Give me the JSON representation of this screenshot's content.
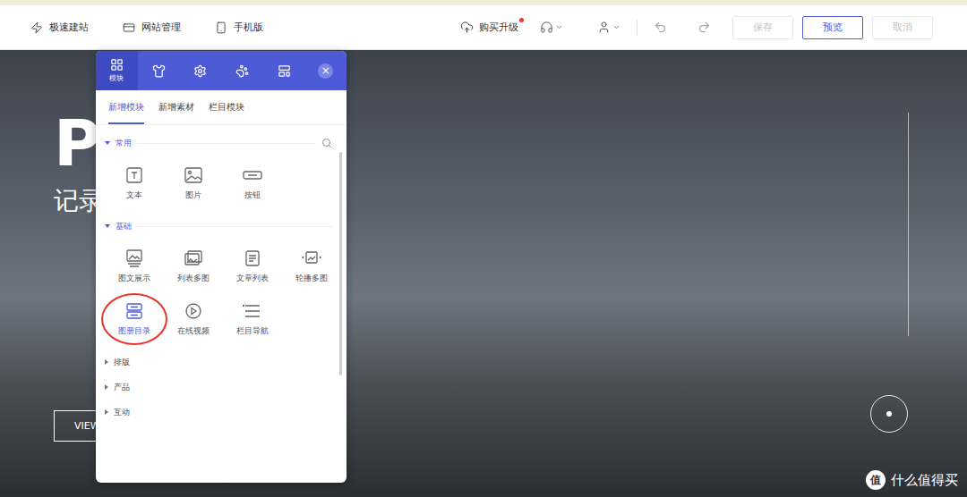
{
  "topbar": {
    "left_items": [
      {
        "label": "极速建站",
        "kind": "zap"
      },
      {
        "label": "网站管理",
        "kind": "manage"
      },
      {
        "label": "手机版",
        "kind": "phone"
      }
    ],
    "upgrade": {
      "label": "购买升级",
      "badge": true
    },
    "buttons": [
      {
        "label": "保存",
        "disabled": true,
        "selected": false
      },
      {
        "label": "预览",
        "disabled": false,
        "selected": true
      },
      {
        "label": "取消",
        "disabled": true,
        "selected": false
      }
    ]
  },
  "hero": {
    "title": "PI",
    "subtitle": "记录",
    "button": "VIEW"
  },
  "panel": {
    "icon_tabs": [
      {
        "label": "模块",
        "kind": "grid",
        "selected": true
      },
      {
        "label": "",
        "kind": "shirt",
        "selected": false
      },
      {
        "label": "",
        "kind": "gear",
        "selected": false
      },
      {
        "label": "",
        "kind": "paw",
        "selected": false
      },
      {
        "label": "",
        "kind": "layout",
        "selected": false
      }
    ],
    "close": "×",
    "sub_tabs": [
      {
        "label": "新增模块",
        "selected": true
      },
      {
        "label": "新增素材",
        "selected": false
      },
      {
        "label": "栏目模块",
        "selected": false
      }
    ],
    "sections": [
      {
        "title": "常用",
        "expanded": true,
        "searchable": true,
        "items": [
          {
            "label": "文本",
            "kind": "text",
            "selected": false
          },
          {
            "label": "图片",
            "kind": "image",
            "selected": false
          },
          {
            "label": "按钮",
            "kind": "button",
            "selected": false
          }
        ]
      },
      {
        "title": "基础",
        "expanded": true,
        "searchable": false,
        "items": [
          {
            "label": "图文展示",
            "kind": "gallery-text",
            "selected": false
          },
          {
            "label": "列表多图",
            "kind": "list-images",
            "selected": false
          },
          {
            "label": "文章列表",
            "kind": "article-list",
            "selected": false
          },
          {
            "label": "轮播多图",
            "kind": "carousel",
            "selected": false
          },
          {
            "label": "图册目录",
            "kind": "catalog",
            "selected": true
          },
          {
            "label": "在线视频",
            "kind": "video",
            "selected": false
          },
          {
            "label": "栏目导航",
            "kind": "nav",
            "selected": false
          }
        ]
      },
      {
        "title": "排版",
        "expanded": false,
        "searchable": false,
        "items": []
      },
      {
        "title": "产品",
        "expanded": false,
        "searchable": false,
        "items": []
      },
      {
        "title": "互动",
        "expanded": false,
        "searchable": false,
        "items": []
      }
    ]
  },
  "watermark": {
    "badge": "值",
    "text": "什么值得买"
  }
}
